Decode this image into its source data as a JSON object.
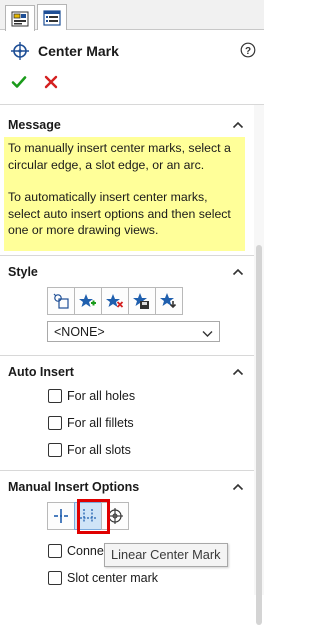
{
  "tabs": [
    {
      "icon": "property-manager-icon"
    },
    {
      "icon": "feature-manager-icon"
    }
  ],
  "header": {
    "title": "Center Mark",
    "help_icon": "help-icon"
  },
  "actions": {
    "ok_icon": "checkmark-icon",
    "cancel_icon": "cancel-icon"
  },
  "message": {
    "label": "Message",
    "paragraph1": "To manually insert center marks, select a circular edge, a slot edge, or an arc.",
    "paragraph2": "To automatically insert center marks, select auto insert options and then select one or more drawing views."
  },
  "style": {
    "label": "Style",
    "buttons": [
      "apply-default-style-icon",
      "add-style-icon",
      "delete-style-icon",
      "save-style-icon",
      "load-style-icon"
    ],
    "selected_value": "<NONE>"
  },
  "auto_insert": {
    "label": "Auto Insert",
    "options": [
      "For all holes",
      "For all fillets",
      "For all slots"
    ]
  },
  "manual_insert": {
    "label": "Manual Insert Options",
    "buttons": [
      "single-center-mark-icon",
      "linear-center-mark-icon",
      "circular-center-mark-icon"
    ],
    "options": [
      "Conne",
      "Slot center mark"
    ],
    "tooltip": "Linear Center Mark"
  },
  "colors": {
    "message_bg": "#ffff99",
    "ok_green": "#1a9b1a",
    "cancel_red": "#d42020",
    "highlight": "#e00000",
    "accent_blue": "#1f4f96"
  }
}
